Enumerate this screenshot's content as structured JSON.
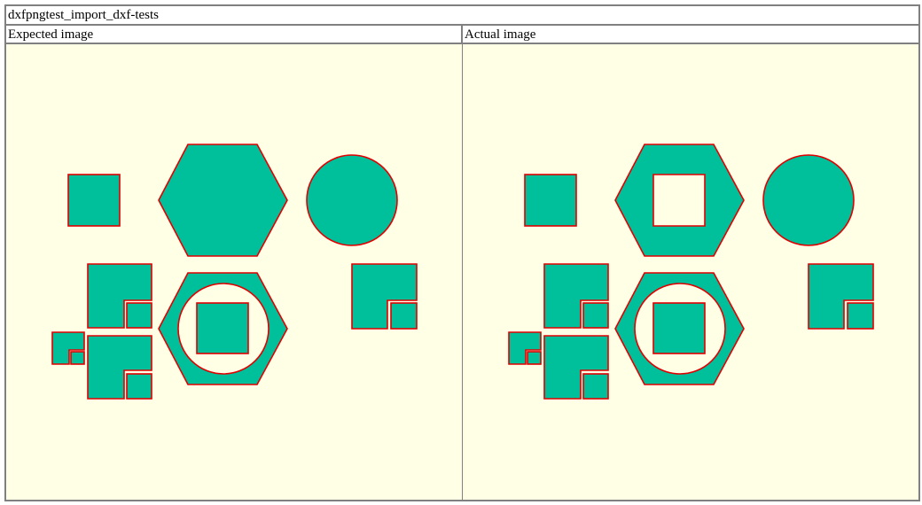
{
  "page": {
    "title": "dxfpngtest_import_dxf-tests"
  },
  "columns": {
    "expected_label": "Expected image",
    "actual_label": "Actual image"
  },
  "colors": {
    "background": "#ffffe6",
    "shape_fill": "#00c09c",
    "shape_stroke": "#e00000",
    "border": "#808080"
  }
}
